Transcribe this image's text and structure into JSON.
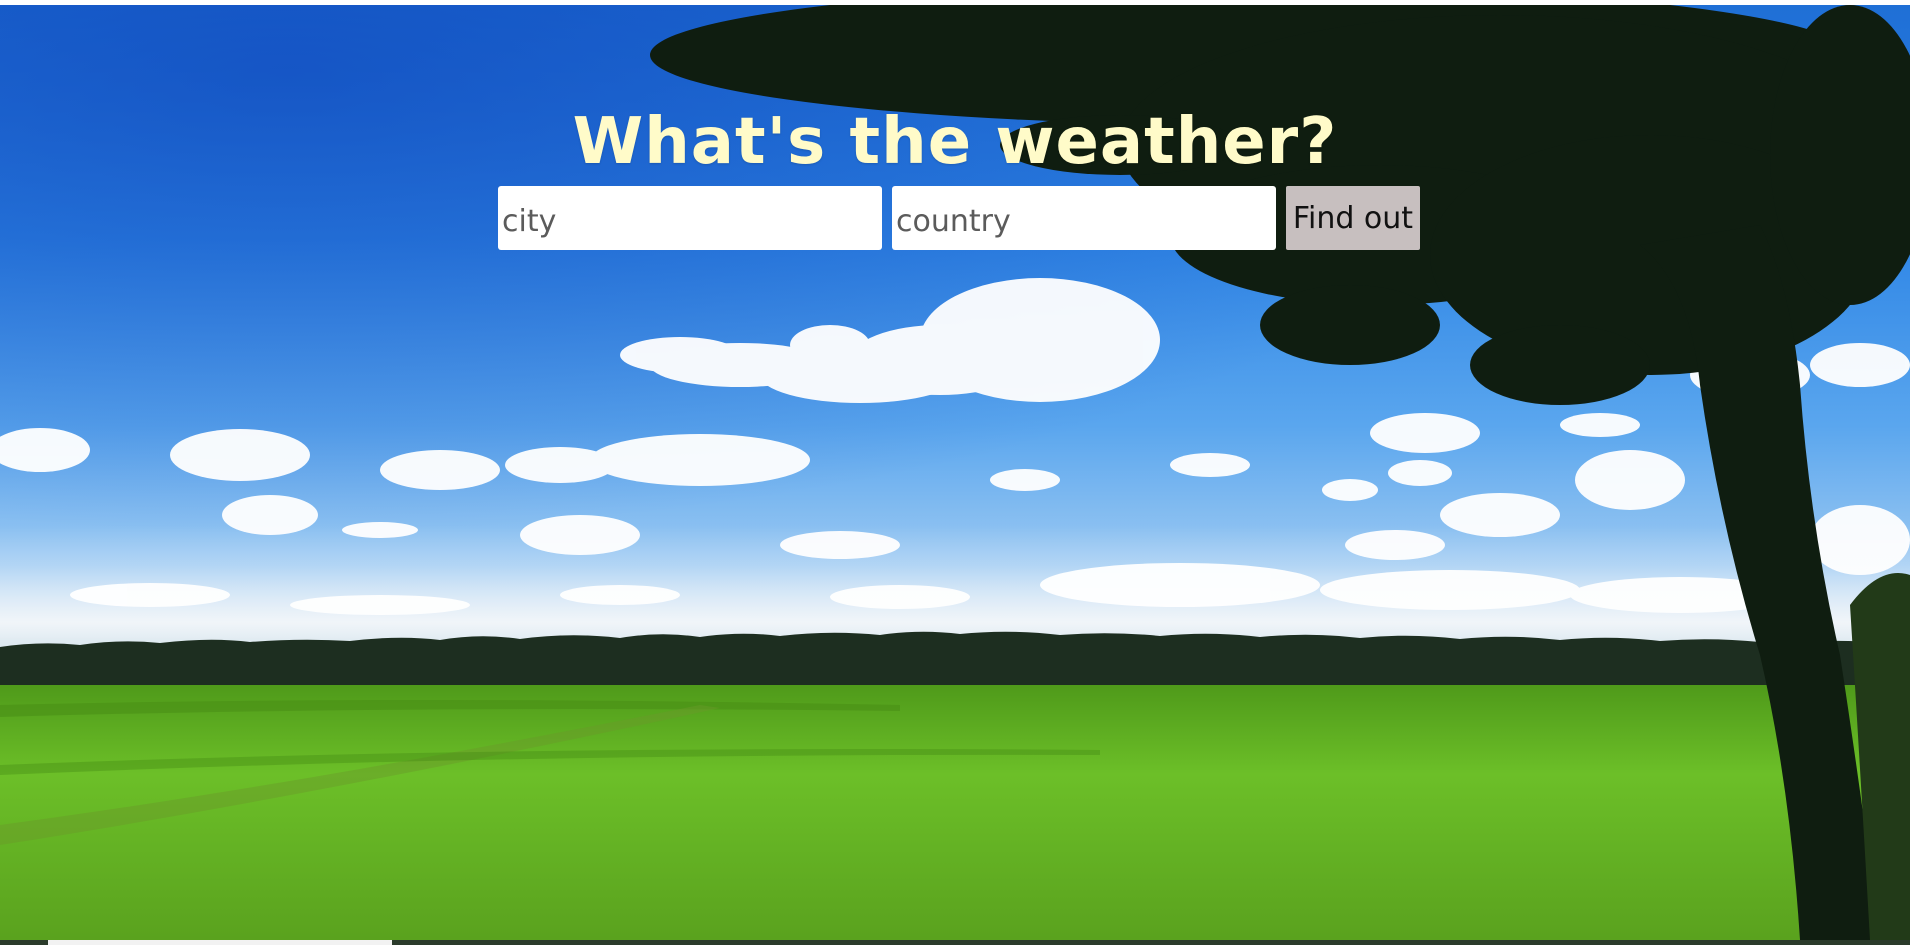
{
  "page": {
    "heading": "What's the weather?"
  },
  "form": {
    "city_placeholder": "city",
    "country_placeholder": "country",
    "submit_label": "Find out"
  },
  "colors": {
    "heading": "#fffbc9",
    "button_bg": "#c7bfbf",
    "sky": "#2f86e6",
    "grass": "#5fae22"
  },
  "background": {
    "description": "sky-clouds-field-tree"
  }
}
